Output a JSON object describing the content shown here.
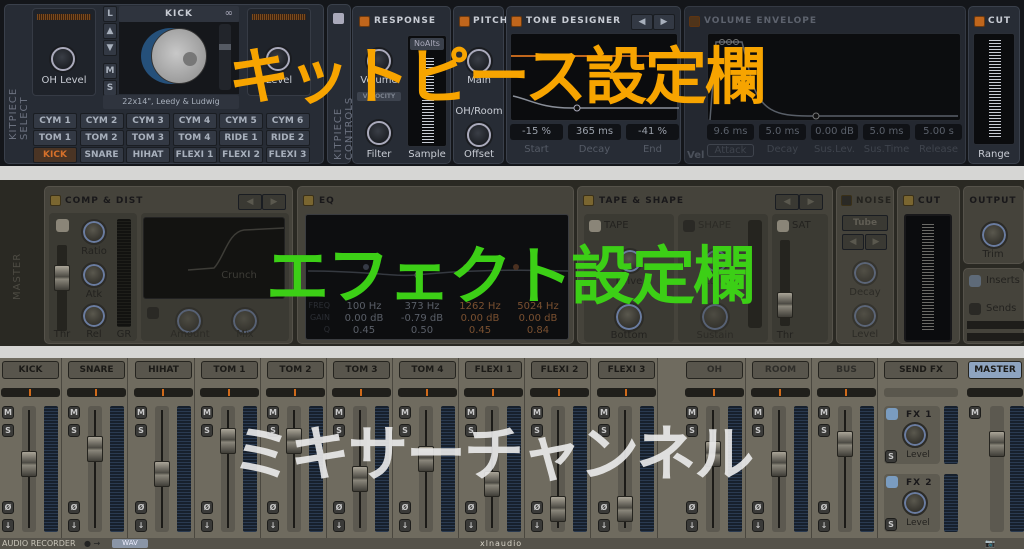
{
  "overlays": {
    "kitpiece": "キットピース設定欄",
    "effects": "エフェクト設定欄",
    "mixer": "ミキサーチャンネル"
  },
  "colors": {
    "orange_overlay": "#f7a400",
    "green_overlay": "#3ccf16",
    "white_overlay": "#ececec",
    "accent": "#c0661c"
  },
  "kitpiece_select": {
    "side_label": "KITPIECE SELECT",
    "left_knob_label": "OH Level",
    "right_knob_label": "Level",
    "piece_title": "KICK",
    "piece_caption": "22x14\", Leedy & Ludwig",
    "side_buttons": [
      "L",
      "M",
      "S"
    ],
    "grid": [
      [
        "CYM 1",
        "CYM 2",
        "CYM 3",
        "CYM 4",
        "CYM 5",
        "CYM 6"
      ],
      [
        "TOM 1",
        "TOM 2",
        "TOM 3",
        "TOM 4",
        "RIDE 1",
        "RIDE 2"
      ],
      [
        "KICK",
        "SNARE",
        "HIHAT",
        "FLEXI 1",
        "FLEXI 2",
        "FLEXI 3"
      ]
    ],
    "selected": "KICK"
  },
  "kitpiece_controls": {
    "side_label": "KITPIECE CONTROLS",
    "response": {
      "title": "RESPONSE",
      "volume": "Volume",
      "velocity": "VELOCITY",
      "filter": "Filter",
      "sample": "Sample",
      "noalts": "NoAlts"
    },
    "pitch": {
      "title": "PITCH",
      "main": "Main",
      "oh_room": "OH/Room",
      "offset": "Offset"
    },
    "tone_designer": {
      "title": "TONE DESIGNER",
      "values": [
        "-15 %",
        "365 ms",
        "-41 %"
      ],
      "labels": [
        "Start",
        "Decay",
        "End"
      ]
    },
    "volume_envelope": {
      "title": "VOLUME ENVELOPE",
      "values": [
        "9.6 ms",
        "5.0 ms",
        "0.00 dB",
        "5.0 ms",
        "5.00 s"
      ],
      "labels": [
        "Attack",
        "Decay",
        "Sus.Lev.",
        "Sus.Time",
        "Release"
      ],
      "vel": "Vel"
    },
    "cut": {
      "title": "CUT",
      "range": "Range"
    }
  },
  "effects": {
    "side_label": "MASTER",
    "comp": {
      "title": "COMP & DIST",
      "ratio": "Ratio",
      "atk": "Atk",
      "rel": "Rel",
      "thr": "Thr",
      "gr": "GR",
      "preset": "Crunch",
      "amount": "Amount",
      "mix": "Mix"
    },
    "eq": {
      "title": "EQ",
      "row_labels": [
        "FREQ",
        "GAIN",
        "Q"
      ],
      "bands": [
        {
          "freq": "100 Hz",
          "gain": "0.00 dB",
          "q": "0.45"
        },
        {
          "freq": "373 Hz",
          "gain": "-0.79 dB",
          "q": "0.50"
        },
        {
          "freq": "1262 Hz",
          "gain": "0.00 dB",
          "q": "0.45"
        },
        {
          "freq": "5024 Hz",
          "gain": "0.00 dB",
          "q": "0.84"
        }
      ]
    },
    "tape": {
      "title": "TAPE & SHAPE",
      "tape": "TAPE",
      "shape": "SHAPE",
      "sat": "SAT",
      "drive": "Drive",
      "attack": "Attack",
      "bottom": "Bottom",
      "sustain": "Sustain",
      "thr": "Thr"
    },
    "noise": {
      "title": "NOISE",
      "type": "Tube",
      "decay": "Decay",
      "level": "Level"
    },
    "cut": {
      "title": "CUT"
    },
    "output": {
      "title": "OUTPUT",
      "trim": "Trim",
      "inserts": "Inserts",
      "sends": "Sends"
    }
  },
  "mixer": {
    "channels": [
      {
        "name": "KICK",
        "fader": 0.55
      },
      {
        "name": "SNARE",
        "fader": 0.7
      },
      {
        "name": "HIHAT",
        "fader": 0.45
      },
      {
        "name": "TOM 1",
        "fader": 0.78
      },
      {
        "name": "TOM 2",
        "fader": 0.78
      },
      {
        "name": "TOM 3",
        "fader": 0.4
      },
      {
        "name": "TOM 4",
        "fader": 0.6
      },
      {
        "name": "FLEXI 1",
        "fader": 0.35
      },
      {
        "name": "FLEXI 2",
        "fader": 0.1
      },
      {
        "name": "FLEXI 3",
        "fader": 0.1
      },
      {
        "name": "OH",
        "fader": 0.65
      },
      {
        "name": "ROOM",
        "fader": 0.55
      },
      {
        "name": "BUS",
        "fader": 0.75
      }
    ],
    "send_fx": {
      "name": "SEND FX",
      "fx1": "FX 1",
      "fx2": "FX 2",
      "level": "Level"
    },
    "master": {
      "name": "MASTER",
      "fader": 0.75
    },
    "buttons": {
      "mute": "M",
      "solo": "S",
      "phase": "Ø",
      "route": "↓"
    }
  },
  "footer": {
    "recorder": "AUDIO RECORDER",
    "format": "WAV",
    "brand": "xlnaudio"
  }
}
